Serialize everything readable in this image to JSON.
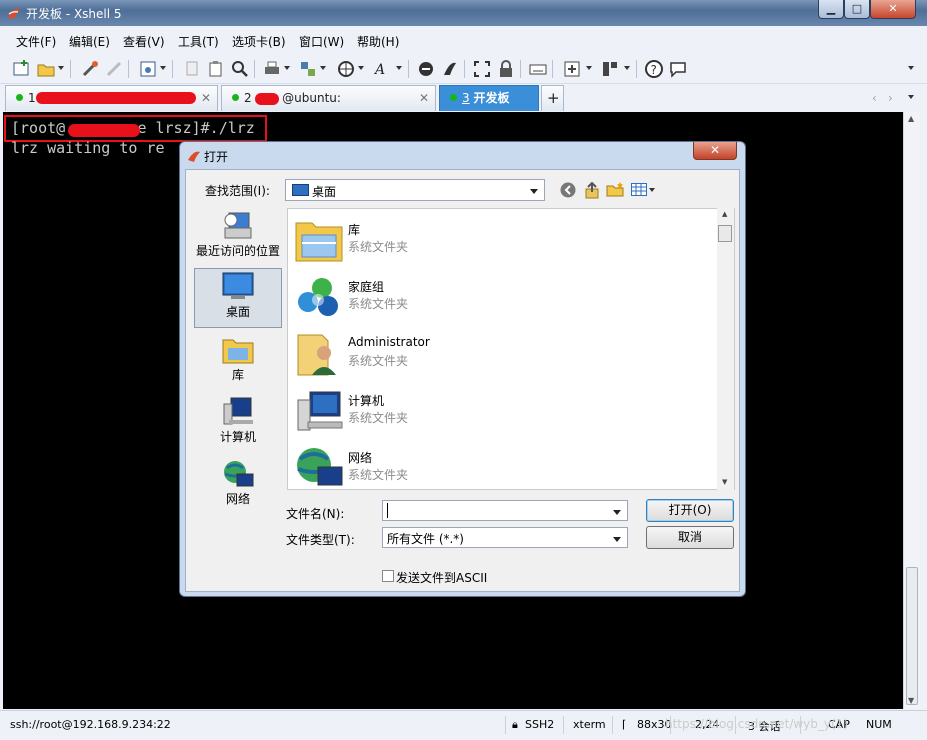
{
  "window": {
    "title": "开发板 - Xshell 5",
    "min": "▁",
    "max": "□",
    "close": "✕"
  },
  "menu": [
    "文件(F)",
    "编辑(E)",
    "查看(V)",
    "工具(T)",
    "选项卡(B)",
    "窗口(W)",
    "帮助(H)"
  ],
  "tabs": [
    {
      "number": "1",
      "label": "",
      "status": "connected"
    },
    {
      "number": "2",
      "label": "@ubuntu: ~/Develop/lrz...",
      "status": "connected"
    },
    {
      "number": "3",
      "label": "开发板",
      "status": "connected",
      "active": true
    }
  ],
  "tab_add": "+",
  "terminal": {
    "line1_prefix": "[root@",
    "line1_suffix": "e lrsz]#./lrz",
    "line2": "lrz waiting to re"
  },
  "dialog": {
    "title": "打开",
    "lookin_label": "查找范围(I):",
    "lookin_value": "桌面",
    "places": [
      "最近访问的位置",
      "桌面",
      "库",
      "计算机",
      "网络"
    ],
    "files": [
      {
        "name": "库",
        "type": "系统文件夹",
        "icon": "library-icon"
      },
      {
        "name": "家庭组",
        "type": "系统文件夹",
        "icon": "homegroup-icon"
      },
      {
        "name": "Administrator",
        "type": "系统文件夹",
        "icon": "user-folder-icon"
      },
      {
        "name": "计算机",
        "type": "系统文件夹",
        "icon": "computer-icon"
      },
      {
        "name": "网络",
        "type": "系统文件夹",
        "icon": "network-icon"
      }
    ],
    "filename_label": "文件名(N):",
    "filename_value": "",
    "filetype_label": "文件类型(T):",
    "filetype_value": "所有文件 (*.*)",
    "open_button": "打开(O)",
    "cancel_button": "取消",
    "ascii_checkbox": "发送文件到ASCII",
    "ascii_checked": false
  },
  "status": {
    "connection": "ssh://root@192.168.9.234:22",
    "protocol": "SSH2",
    "term": "xterm",
    "size": "88x30",
    "cursor": "2,24",
    "sessions": "3 会话",
    "caps": "CAP",
    "num": "NUM"
  },
  "watermark": "https://blog.csdn.net/wyb_y(1)"
}
